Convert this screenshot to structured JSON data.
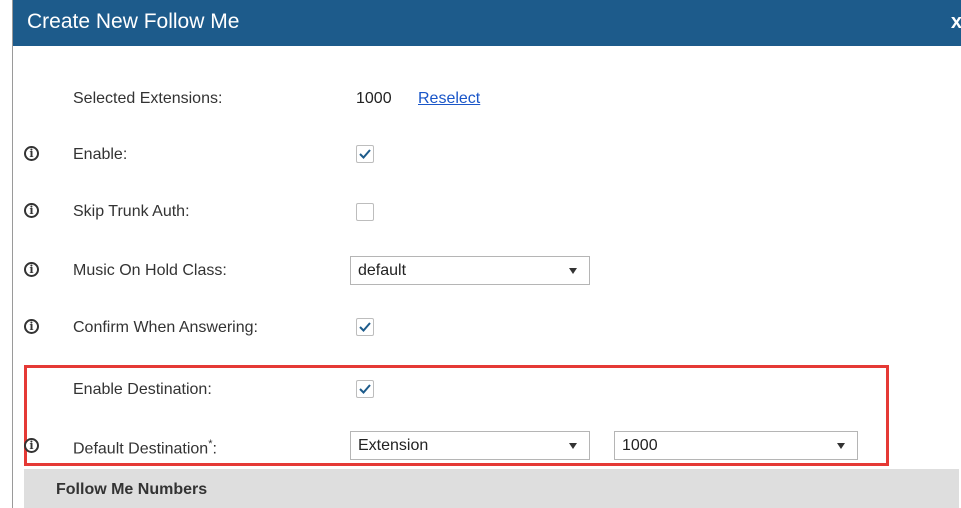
{
  "dialog": {
    "title": "Create New Follow Me",
    "close_label": "x"
  },
  "form": {
    "selected_extensions": {
      "label": "Selected Extensions:",
      "value": "1000",
      "reselect": "Reselect"
    },
    "enable": {
      "label": "Enable:",
      "checked": true
    },
    "skip_trunk_auth": {
      "label": "Skip Trunk Auth:",
      "checked": false
    },
    "music_on_hold_class": {
      "label": "Music On Hold Class:",
      "value": "default"
    },
    "confirm_when_answering": {
      "label": "Confirm When Answering:",
      "checked": true
    },
    "enable_destination": {
      "label": "Enable Destination:",
      "checked": true
    },
    "default_destination": {
      "label": "Default Destination",
      "required_mark": "*",
      "suffix": ":",
      "type_value": "Extension",
      "target_value": "1000"
    }
  },
  "section": {
    "title": "Follow Me Numbers"
  },
  "colors": {
    "titlebar": "#1d5b8b",
    "highlight": "#e53935",
    "link": "#1a56c8"
  }
}
